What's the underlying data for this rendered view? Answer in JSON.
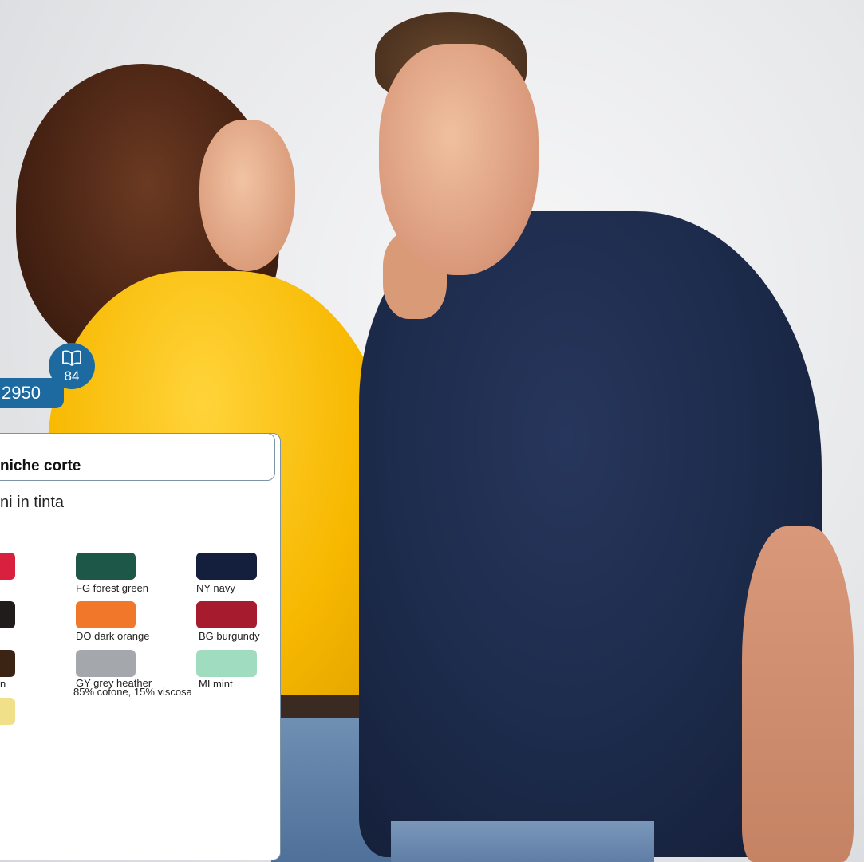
{
  "product": {
    "code": "2950",
    "page_ref": "84",
    "title": "niche corte",
    "subtitle": "ni in tinta"
  },
  "colors": {
    "brand_blue": "#1d6aa0",
    "panel_border": "#7d93a6"
  },
  "swatches": [
    {
      "key": "partial-red",
      "label": "",
      "color": "#d9203e"
    },
    {
      "key": "partial-black",
      "label": "",
      "color": "#201c1c"
    },
    {
      "key": "partial-brown",
      "label": "n",
      "color": "#3b2414"
    },
    {
      "key": "partial-yellow",
      "label": "",
      "color": "#f1e08a"
    },
    {
      "key": "forest-green",
      "label": "FG forest green",
      "color": "#1c5748"
    },
    {
      "key": "dark-orange",
      "label": "DO dark orange",
      "color": "#f1782a"
    },
    {
      "key": "grey-heather",
      "label": "GY grey heather",
      "note": "85% cotone, 15% viscosa",
      "color": "#a4a8ad"
    },
    {
      "key": "navy",
      "label": "NY navy",
      "color": "#141f3d"
    },
    {
      "key": "burgundy",
      "label": "BG burgundy",
      "color": "#a61c2e"
    },
    {
      "key": "mint",
      "label": "MI mint",
      "color": "#9fdcc0"
    }
  ]
}
